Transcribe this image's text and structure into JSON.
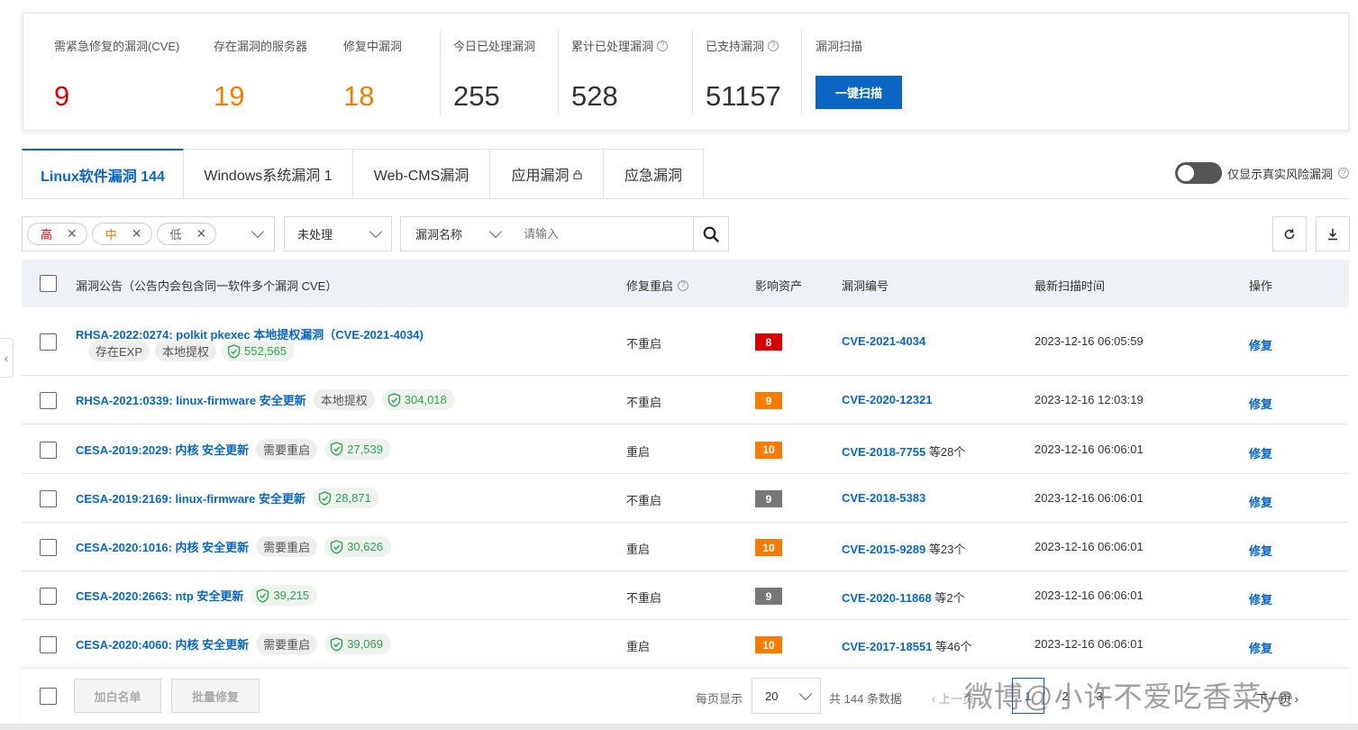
{
  "stats": {
    "urgent_label": "需紧急修复的漏洞(CVE)",
    "urgent_value": "9",
    "servers_label": "存在漏洞的服务器",
    "servers_value": "19",
    "fixing_label": "修复中漏洞",
    "fixing_value": "18",
    "today_label": "今日已处理漏洞",
    "today_value": "255",
    "total_label": "累计已处理漏洞",
    "total_value": "528",
    "supported_label": "已支持漏洞",
    "supported_value": "51157",
    "scan_label": "漏洞扫描",
    "scan_button": "一键扫描"
  },
  "tabs": [
    {
      "label": "Linux软件漏洞 144"
    },
    {
      "label": "Windows系统漏洞 1"
    },
    {
      "label": "Web-CMS漏洞"
    },
    {
      "label": "应用漏洞"
    },
    {
      "label": "应急漏洞"
    }
  ],
  "toggle_label": "仅显示真实风险漏洞",
  "filters": {
    "chips": [
      {
        "label": "高",
        "color": "#d70000"
      },
      {
        "label": "中",
        "color": "#f57c00"
      },
      {
        "label": "低",
        "color": "#666666"
      }
    ],
    "status": "未处理",
    "search_field": "漏洞名称",
    "search_placeholder": "请输入"
  },
  "table": {
    "headers": {
      "title": "漏洞公告（公告内会包含同一软件多个漏洞 CVE）",
      "restart": "修复重启",
      "assets": "影响资产",
      "cve": "漏洞编号",
      "time": "最新扫描时间",
      "action": "操作"
    },
    "rows": [
      {
        "title": "RHSA-2022:0274: polkit pkexec 本地提权漏洞（CVE-2021-4034)",
        "tags": [
          "存在EXP",
          "本地提权"
        ],
        "count": "552,565",
        "restart": "不重启",
        "assets": "8",
        "assets_color": "#d70000",
        "cve": "CVE-2021-4034",
        "cve_extra": "",
        "time": "2023-12-16 06:05:59",
        "action": "修复"
      },
      {
        "title": "RHSA-2021:0339: linux-firmware 安全更新",
        "tags": [
          "本地提权"
        ],
        "count": "304,018",
        "restart": "不重启",
        "assets": "9",
        "assets_color": "#f57c00",
        "cve": "CVE-2020-12321",
        "cve_extra": "",
        "time": "2023-12-16 12:03:19",
        "action": "修复"
      },
      {
        "title": "CESA-2019:2029: 内核 安全更新",
        "tags": [
          "需要重启"
        ],
        "count": "27,539",
        "restart": "重启",
        "assets": "10",
        "assets_color": "#f57c00",
        "cve": "CVE-2018-7755",
        "cve_extra": "等28个",
        "time": "2023-12-16 06:06:01",
        "action": "修复"
      },
      {
        "title": "CESA-2019:2169: linux-firmware 安全更新",
        "tags": [],
        "count": "28,871",
        "restart": "不重启",
        "assets": "9",
        "assets_color": "#777777",
        "cve": "CVE-2018-5383",
        "cve_extra": "",
        "time": "2023-12-16 06:06:01",
        "action": "修复"
      },
      {
        "title": "CESA-2020:1016: 内核 安全更新",
        "tags": [
          "需要重启"
        ],
        "count": "30,626",
        "restart": "重启",
        "assets": "10",
        "assets_color": "#f57c00",
        "cve": "CVE-2015-9289",
        "cve_extra": "等23个",
        "time": "2023-12-16 06:06:01",
        "action": "修复"
      },
      {
        "title": "CESA-2020:2663: ntp 安全更新",
        "tags": [],
        "count": "39,215",
        "restart": "不重启",
        "assets": "9",
        "assets_color": "#777777",
        "cve": "CVE-2020-11868",
        "cve_extra": "等2个",
        "time": "2023-12-16 06:06:01",
        "action": "修复"
      },
      {
        "title": "CESA-2020:4060: 内核 安全更新",
        "tags": [
          "需要重启"
        ],
        "count": "39,069",
        "restart": "重启",
        "assets": "10",
        "assets_color": "#f57c00",
        "cve": "CVE-2017-18551",
        "cve_extra": "等46个",
        "time": "2023-12-16 06:06:01",
        "action": "修复"
      }
    ]
  },
  "footer": {
    "whitelist_button": "加白名单",
    "batch_fix_button": "批量修复",
    "per_page_label": "每页显示",
    "per_page_value": "20",
    "total_text": "共 144 条数据",
    "prev_label": "上一页",
    "current_page": "1",
    "pages": [
      "2",
      "3"
    ],
    "next_label": "下一页"
  },
  "watermark": "微博@小许不爱吃香菜ye"
}
